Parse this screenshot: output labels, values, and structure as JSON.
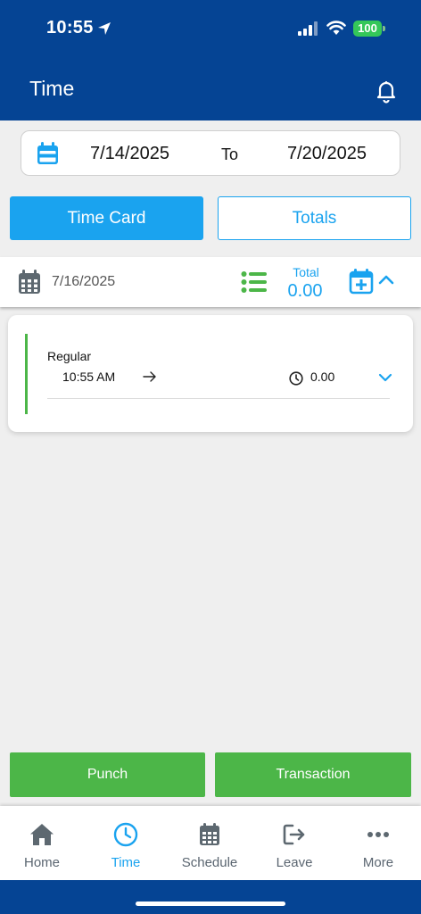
{
  "status": {
    "time": "10:55",
    "battery": "100"
  },
  "header": {
    "title": "Time"
  },
  "date_range": {
    "from": "7/14/2025",
    "to_label": "To",
    "to": "7/20/2025"
  },
  "tabs": [
    {
      "label": "Time Card",
      "active": true
    },
    {
      "label": "Totals",
      "active": false
    }
  ],
  "day": {
    "date": "7/16/2025",
    "total_label": "Total",
    "total_value": "0.00"
  },
  "entries": [
    {
      "type": "Regular",
      "start_time": "10:55 AM",
      "hours": "0.00"
    }
  ],
  "actions": {
    "punch_label": "Punch",
    "transaction_label": "Transaction"
  },
  "nav": [
    {
      "label": "Home",
      "icon": "home-icon"
    },
    {
      "label": "Time",
      "icon": "clock-icon",
      "active": true
    },
    {
      "label": "Schedule",
      "icon": "calendar-grid-icon"
    },
    {
      "label": "Leave",
      "icon": "leave-icon"
    },
    {
      "label": "More",
      "icon": "more-dots-icon"
    }
  ],
  "colors": {
    "brand": "#054494",
    "accent": "#1aa3ef",
    "green": "#4cb648"
  }
}
